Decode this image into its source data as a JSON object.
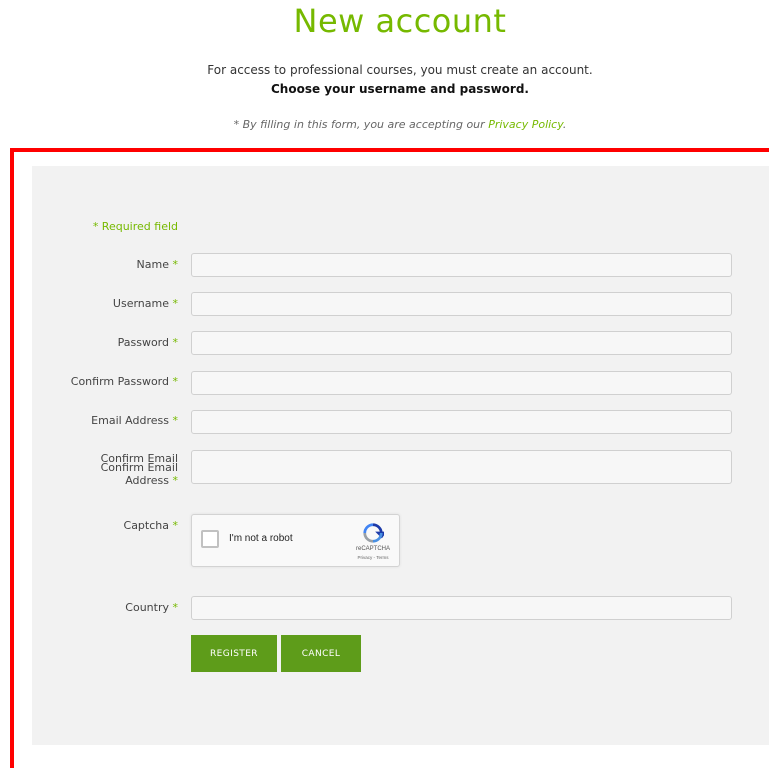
{
  "header": {
    "title": "New account",
    "intro": "For access to professional courses, you must create an account.",
    "intro_strong": "Choose your username and password.",
    "privacy_prefix": "* By filling in this form, you are accepting our ",
    "privacy_link": "Privacy Policy",
    "privacy_suffix": "."
  },
  "form": {
    "required_note": "* Required field",
    "star": "*",
    "fields": {
      "name": {
        "label": "Name",
        "value": ""
      },
      "username": {
        "label": "Username",
        "value": ""
      },
      "password": {
        "label": "Password",
        "value": ""
      },
      "confirm_password": {
        "label": "Confirm Password",
        "value": ""
      },
      "email": {
        "label": "Email Address",
        "value": ""
      },
      "confirm_email": {
        "label_line1": "Confirm Email",
        "label_line2": "Confirm Email",
        "label_line3": "Address",
        "value": ""
      },
      "captcha": {
        "label": "Captcha"
      },
      "country": {
        "label": "Country",
        "value": ""
      }
    },
    "captcha_widget": {
      "checkbox_label": "I'm not a robot",
      "brand": "reCAPTCHA",
      "links": "Privacy - Terms"
    },
    "buttons": {
      "register": "REGISTER",
      "cancel": "CANCEL"
    }
  },
  "colors": {
    "accent": "#76b900",
    "button": "#5e9c1a",
    "frame": "#ff0000",
    "panel": "#f2f2f2"
  }
}
